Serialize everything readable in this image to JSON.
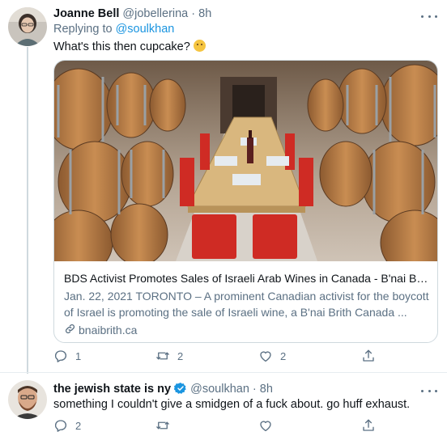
{
  "tweets": [
    {
      "display_name": "Joanne Bell",
      "handle": "@jobellerina",
      "separator": "·",
      "time": "8h",
      "replying_prefix": "Replying to",
      "replying_to": "@soulkhan",
      "text": "What's this then cupcake?",
      "emoji": "thinking-face-emoji",
      "card": {
        "title": "BDS Activist Promotes Sales of Israeli Arab Wines in Canada - B'nai Brith...",
        "description_line1": "Jan. 22, 2021 TORONTO – A prominent Canadian activist for the boycott",
        "description_line2": "of Israel is promoting the sale of Israeli wine, a B'nai Brith Canada ...",
        "domain": "bnaibrith.ca"
      },
      "actions": {
        "replies": "1",
        "retweets": "2",
        "likes": "2"
      }
    },
    {
      "display_name": "the jewish state is ny",
      "verified": true,
      "handle": "@soulkhan",
      "separator": "·",
      "time": "8h",
      "text": "something I couldn't give a smidgen of a fuck about. go huff exhaust.",
      "actions": {
        "replies": "2",
        "retweets": "",
        "likes": ""
      }
    }
  ],
  "colors": {
    "accent": "#1b95e0",
    "secondary_text": "#5b7083",
    "primary_text": "#0f1419",
    "border": "#cfd9de"
  },
  "icons": [
    "reply-icon",
    "retweet-icon",
    "like-icon",
    "share-icon",
    "more-icon",
    "verified-badge-icon",
    "link-icon"
  ]
}
